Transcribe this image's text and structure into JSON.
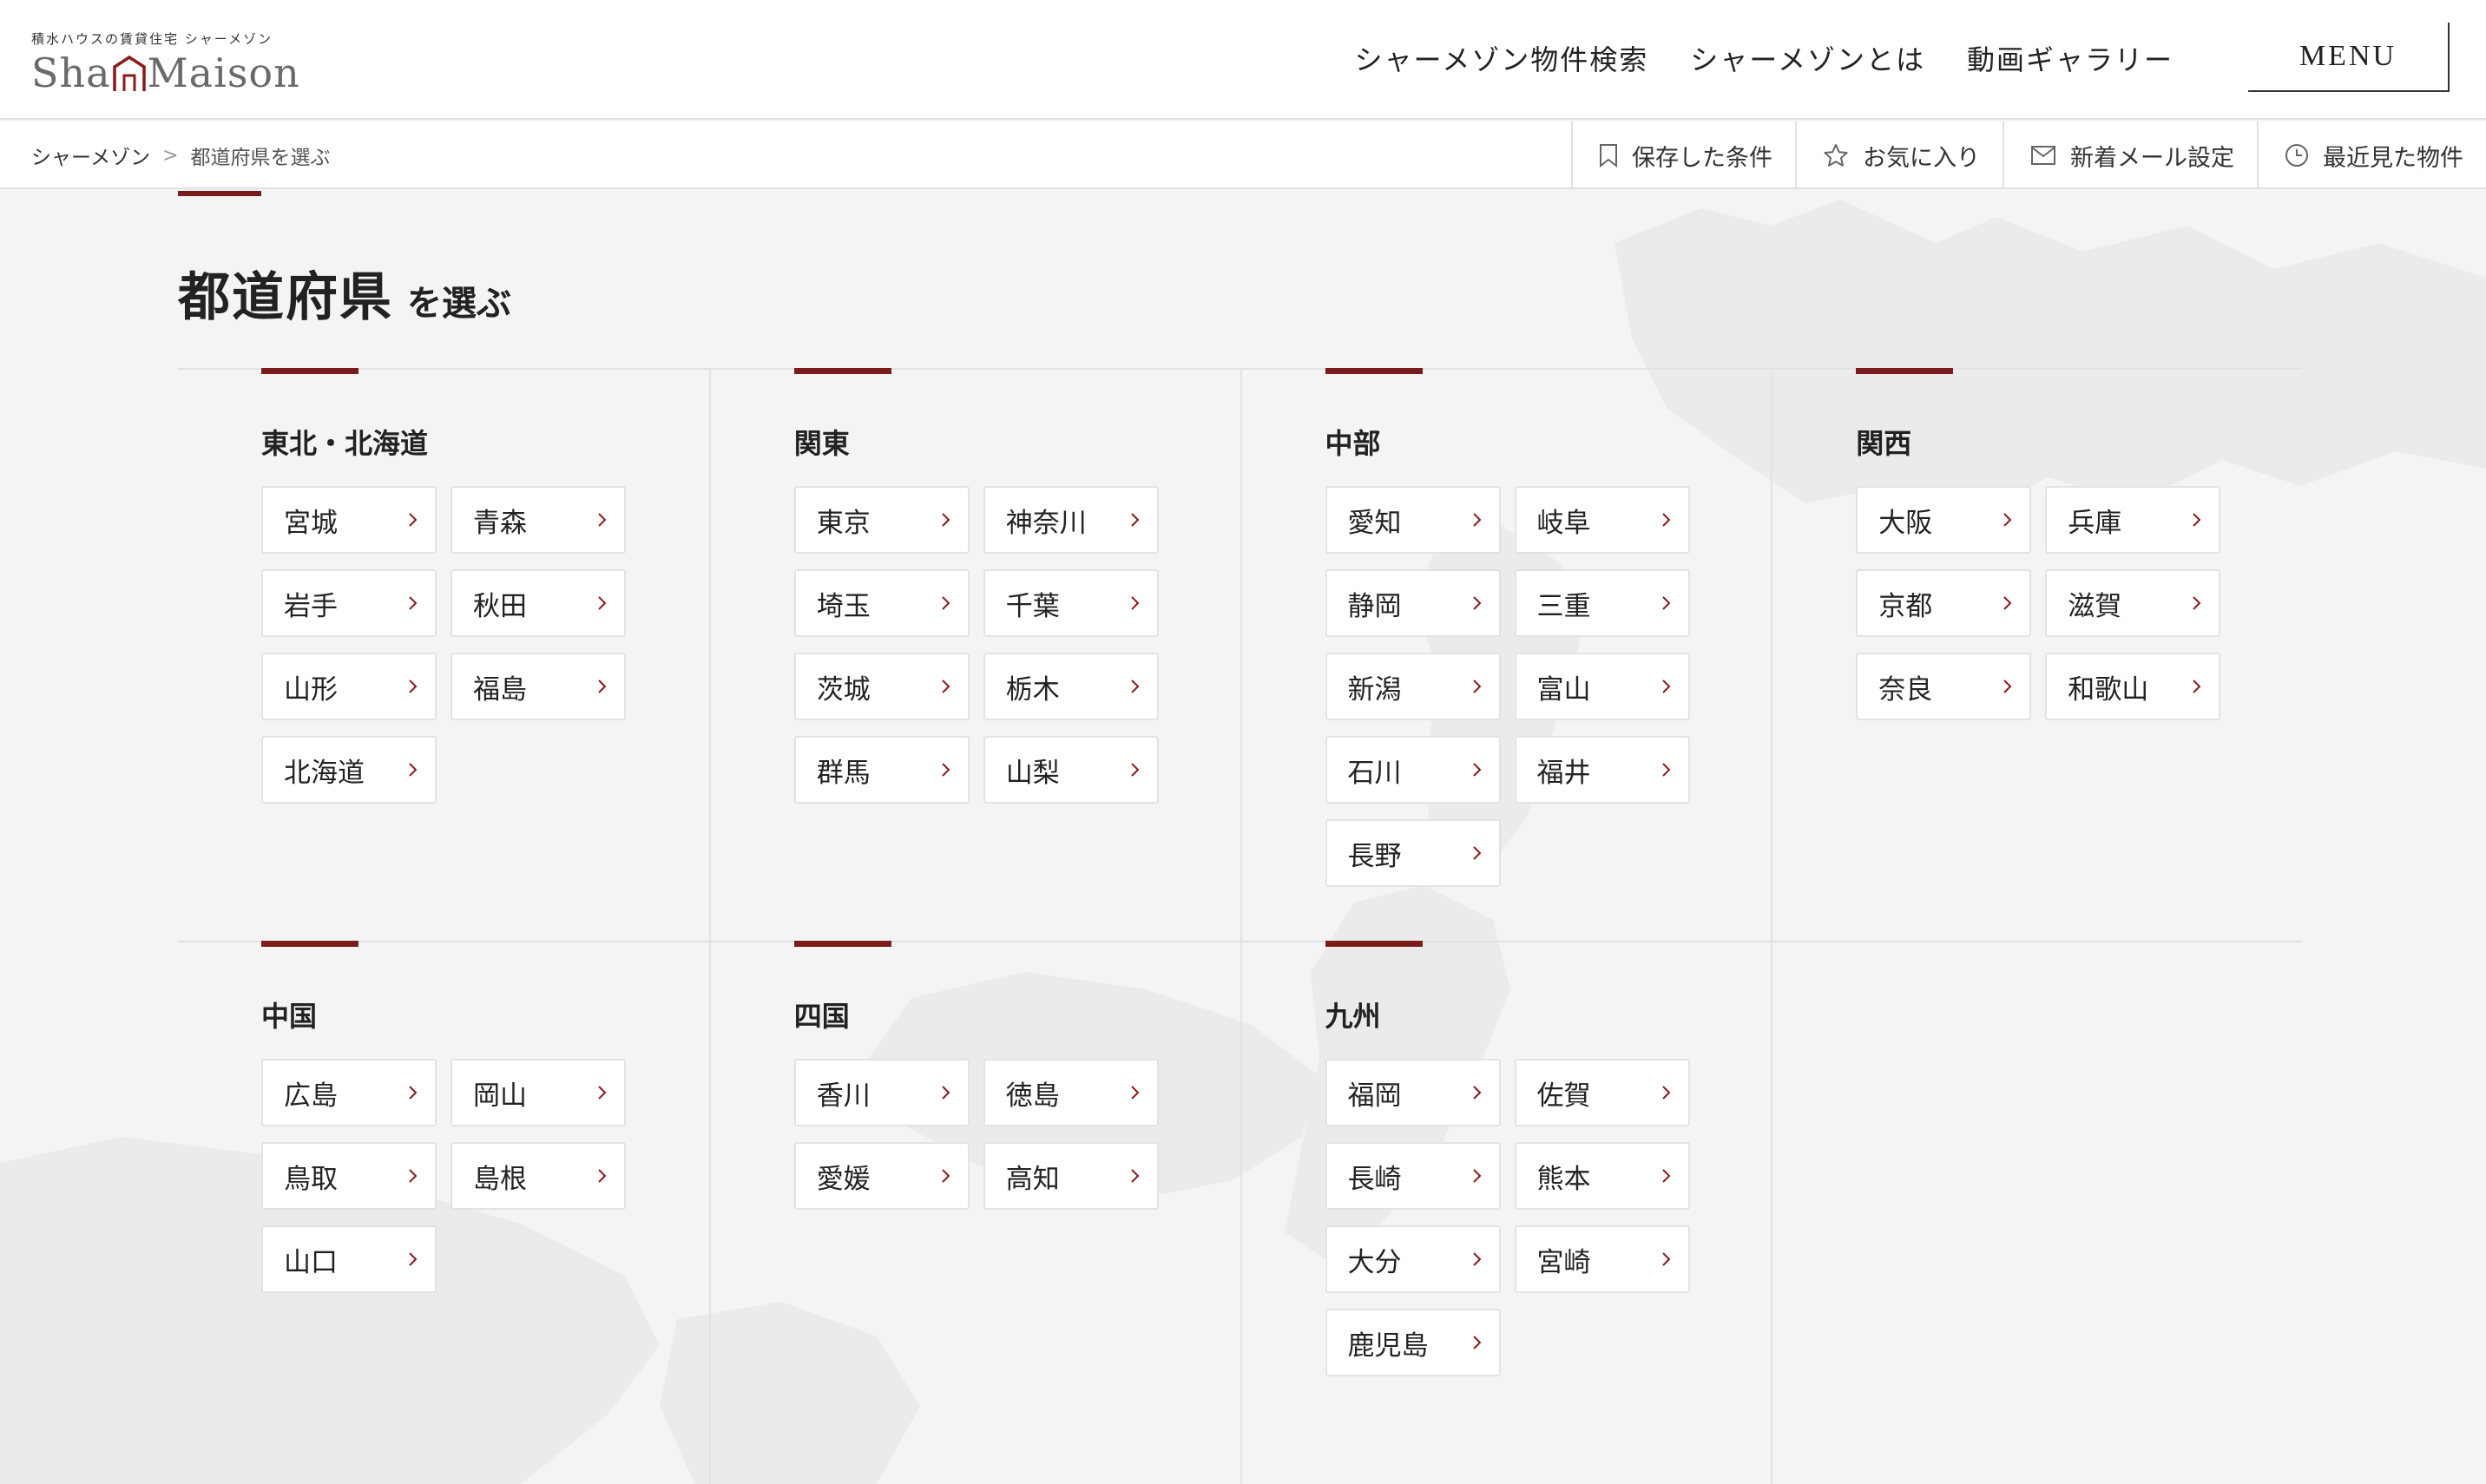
{
  "header": {
    "logo_tagline": "積水ハウスの賃貸住宅 シャーメゾン",
    "logo_text_left": "Sha",
    "logo_text_right": "Maison",
    "nav": [
      {
        "label": "シャーメゾン物件検索"
      },
      {
        "label": "シャーメゾンとは"
      },
      {
        "label": "動画ギャラリー"
      }
    ],
    "menu_label": "MENU"
  },
  "breadcrumb": {
    "home": "シャーメゾン",
    "separator": ">",
    "current": "都道府県を選ぶ"
  },
  "tools": [
    {
      "label": "保存した条件",
      "icon": "bookmark-icon"
    },
    {
      "label": "お気に入り",
      "icon": "star-icon"
    },
    {
      "label": "新着メール設定",
      "icon": "mail-icon"
    },
    {
      "label": "最近見た物件",
      "icon": "clock-icon"
    }
  ],
  "page_title": {
    "main": "都道府県",
    "suffix": "を選ぶ"
  },
  "regions": [
    {
      "name": "東北・北海道",
      "prefectures": [
        "宮城",
        "青森",
        "岩手",
        "秋田",
        "山形",
        "福島",
        "北海道"
      ]
    },
    {
      "name": "関東",
      "prefectures": [
        "東京",
        "神奈川",
        "埼玉",
        "千葉",
        "茨城",
        "栃木",
        "群馬",
        "山梨"
      ]
    },
    {
      "name": "中部",
      "prefectures": [
        "愛知",
        "岐阜",
        "静岡",
        "三重",
        "新潟",
        "富山",
        "石川",
        "福井",
        "長野"
      ]
    },
    {
      "name": "関西",
      "prefectures": [
        "大阪",
        "兵庫",
        "京都",
        "滋賀",
        "奈良",
        "和歌山"
      ]
    },
    {
      "name": "中国",
      "prefectures": [
        "広島",
        "岡山",
        "鳥取",
        "島根",
        "山口"
      ]
    },
    {
      "name": "四国",
      "prefectures": [
        "香川",
        "徳島",
        "愛媛",
        "高知"
      ]
    },
    {
      "name": "九州",
      "prefectures": [
        "福岡",
        "佐賀",
        "長崎",
        "熊本",
        "大分",
        "宮崎",
        "鹿児島"
      ]
    }
  ],
  "colors": {
    "accent": "#7a1c1c",
    "chevron": "#8b1a1a",
    "background": "#f4f4f4",
    "border": "#e2e2e2"
  }
}
